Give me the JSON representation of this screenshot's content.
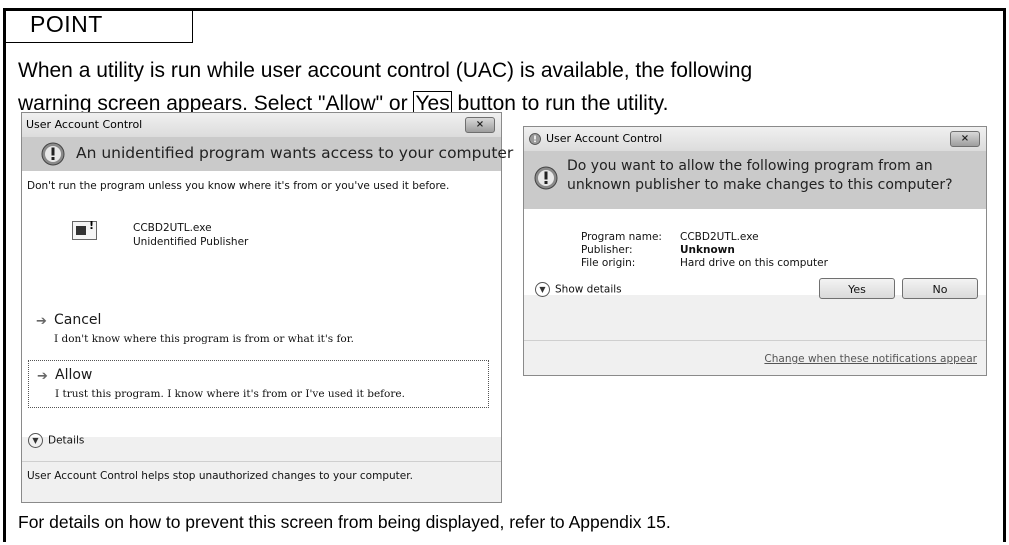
{
  "point": {
    "label": "POINT"
  },
  "intro": {
    "line1": "When a utility is run while user account control (UAC) is available, the following",
    "line2_before": "warning screen appears. Select \"Allow\" or ",
    "line2_boxed": "Yes",
    "line2_after": " button to run the utility."
  },
  "dialog1": {
    "title": "User Account Control",
    "close": "×",
    "heading": "An unidentified program wants access to your computer",
    "warning": "Don't run the program unless you know where it's from or you've used it before.",
    "program_file": "CCBD2UTL.exe",
    "publisher": "Unidentified Publisher",
    "cancel_title": "Cancel",
    "cancel_desc": "I don't know where this program is from or what it's for.",
    "allow_title": "Allow",
    "allow_desc": "I trust this program. I know where it's from or I've used it before.",
    "details": "Details",
    "footer": "User Account Control helps stop unauthorized changes to your computer."
  },
  "dialog2": {
    "title": "User Account Control",
    "close": "×",
    "heading": "Do you want to allow the following program from an unknown publisher to make changes to this computer?",
    "program_name_label": "Program name:",
    "program_name_value": "CCBD2UTL.exe",
    "publisher_label": "Publisher:",
    "publisher_value": "Unknown",
    "origin_label": "File origin:",
    "origin_value": "Hard drive on this computer",
    "show_details": "Show details",
    "yes": "Yes",
    "no": "No",
    "change_link": "Change when these notifications appear"
  },
  "footer": "For details on how to prevent this screen from being displayed, refer to Appendix 15."
}
